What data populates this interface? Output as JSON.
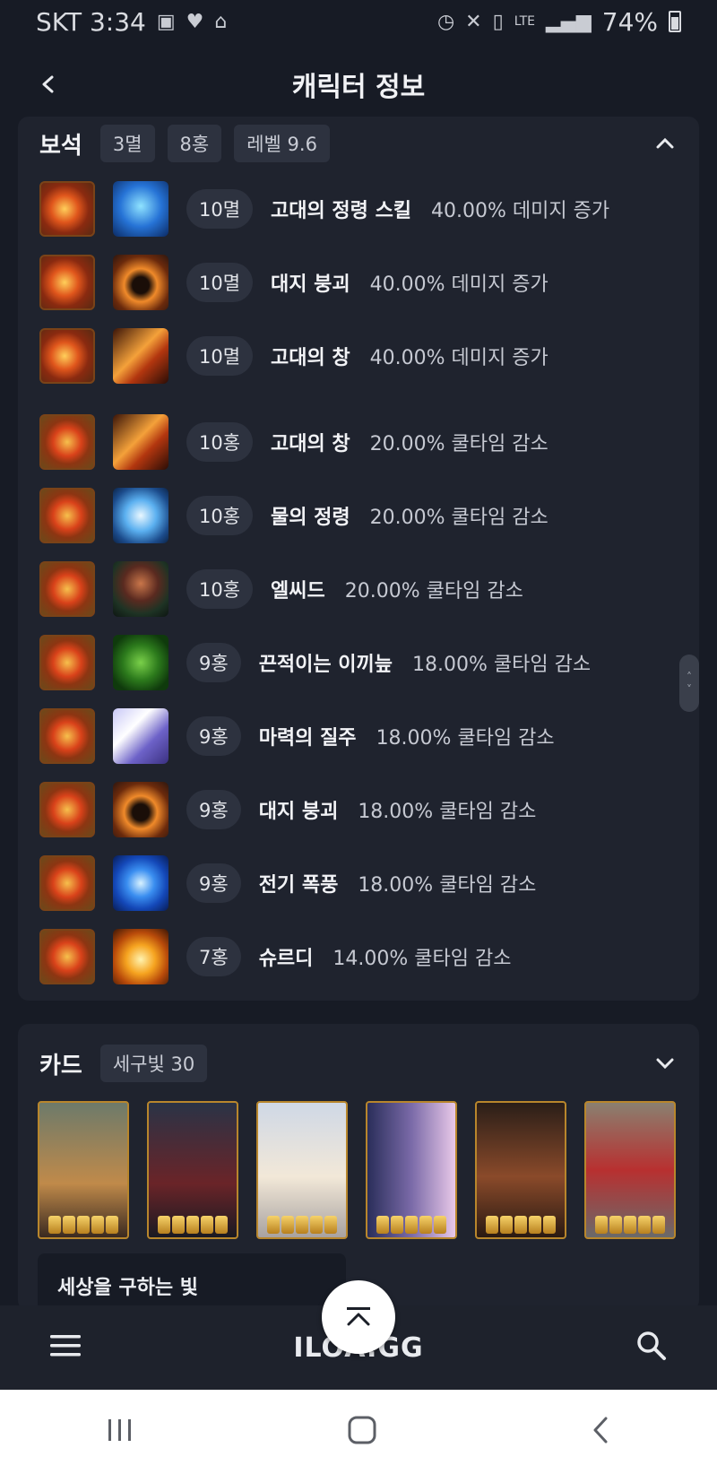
{
  "status_bar": {
    "carrier_time": "SKT 3:34",
    "network": "LTE",
    "battery": "74%"
  },
  "header": {
    "title": "캐릭터 정보"
  },
  "gems": {
    "title": "보석",
    "chips": [
      "3멸",
      "8홍",
      "레벨 9.6"
    ],
    "items": [
      {
        "type": "myeol",
        "level": "10멸",
        "skill": "고대의 정령 스킬",
        "effect": "40.00% 데미지 증가"
      },
      {
        "type": "myeol",
        "level": "10멸",
        "skill": "대지 붕괴",
        "effect": "40.00% 데미지 증가"
      },
      {
        "type": "myeol",
        "level": "10멸",
        "skill": "고대의 창",
        "effect": "40.00% 데미지 증가"
      },
      {
        "type": "hong",
        "level": "10홍",
        "skill": "고대의 창",
        "effect": "20.00% 쿨타임 감소"
      },
      {
        "type": "hong",
        "level": "10홍",
        "skill": "물의 정령",
        "effect": "20.00% 쿨타임 감소"
      },
      {
        "type": "hong",
        "level": "10홍",
        "skill": "엘씨드",
        "effect": "20.00% 쿨타임 감소"
      },
      {
        "type": "hong",
        "level": "9홍",
        "skill": "끈적이는 이끼늪",
        "effect": "18.00% 쿨타임 감소"
      },
      {
        "type": "hong",
        "level": "9홍",
        "skill": "마력의 질주",
        "effect": "18.00% 쿨타임 감소"
      },
      {
        "type": "hong",
        "level": "9홍",
        "skill": "대지 붕괴",
        "effect": "18.00% 쿨타임 감소"
      },
      {
        "type": "hong",
        "level": "9홍",
        "skill": "전기 폭풍",
        "effect": "18.00% 쿨타임 감소"
      },
      {
        "type": "hong",
        "level": "7홍",
        "skill": "슈르디",
        "effect": "14.00% 쿨타임 감소"
      }
    ]
  },
  "cards": {
    "title": "카드",
    "chip": "세구빛 30",
    "set_name": "세상을 구하는 빛",
    "count": 6
  },
  "app_bar": {
    "logo": "ILOA.GG"
  },
  "icons": {
    "back": "chevron-left-icon",
    "collapse": "chevron-up-icon",
    "expand": "chevron-down-icon",
    "menu": "hamburger-menu-icon",
    "search": "search-icon",
    "top": "scroll-to-top-icon"
  },
  "colors": {
    "background": "#171b25",
    "panel": "#1f232e",
    "chip": "#2d323f",
    "card_border": "#b8862c"
  }
}
